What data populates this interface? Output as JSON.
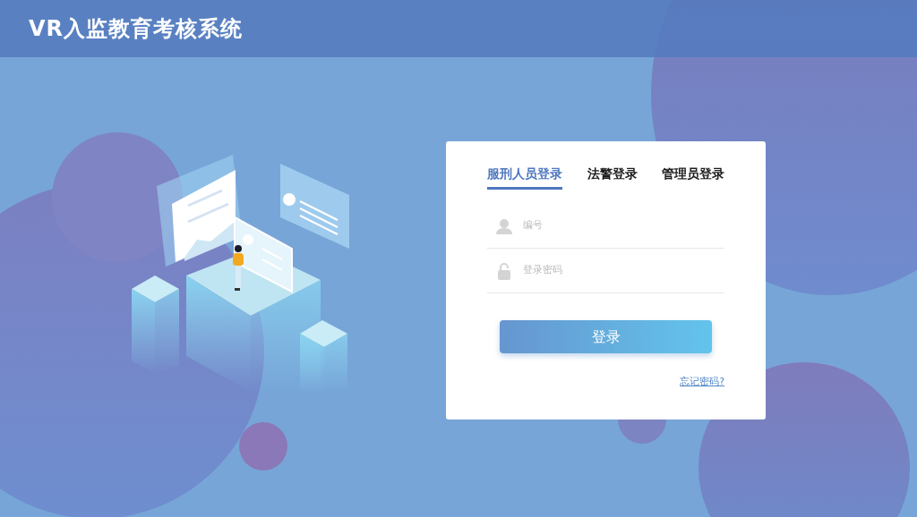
{
  "header": {
    "title": "VR入监教育考核系统"
  },
  "login": {
    "tabs": [
      {
        "label": "服刑人员登录",
        "selected": true
      },
      {
        "label": "法警登录",
        "selected": false
      },
      {
        "label": "管理员登录",
        "selected": false
      }
    ],
    "fields": [
      {
        "kind": "user",
        "placeholder": "编号"
      },
      {
        "kind": "password",
        "placeholder": "登录密码"
      }
    ],
    "submit": "登录",
    "forgot_link": "忘记密码?"
  }
}
